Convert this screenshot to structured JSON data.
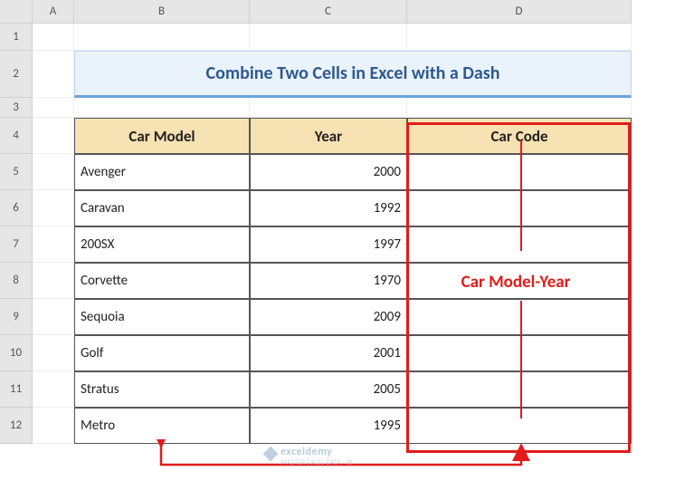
{
  "columns": [
    "",
    "A",
    "B",
    "C",
    "D"
  ],
  "rows": [
    "1",
    "2",
    "3",
    "4",
    "5",
    "6",
    "7",
    "8",
    "9",
    "10",
    "11",
    "12"
  ],
  "title": "Combine Two Cells in Excel with a Dash",
  "headers": {
    "b": "Car Model",
    "c": "Year",
    "d": "Car Code"
  },
  "data": [
    {
      "model": "Avenger",
      "year": "2000"
    },
    {
      "model": "Caravan",
      "year": "1992"
    },
    {
      "model": "200SX",
      "year": "1997"
    },
    {
      "model": "Corvette",
      "year": "1970"
    },
    {
      "model": "Sequoia",
      "year": "2009"
    },
    {
      "model": "Golf",
      "year": "2001"
    },
    {
      "model": "Stratus",
      "year": "2005"
    },
    {
      "model": "Metro",
      "year": "1995"
    }
  ],
  "annotation": "Car Model-Year",
  "watermark": "exceldemy",
  "watermark_sub": "MASTER EXCEL DATA - BI"
}
